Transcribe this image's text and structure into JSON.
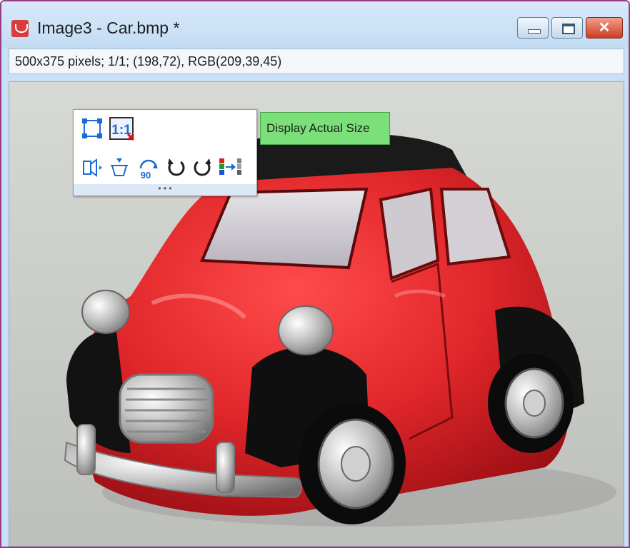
{
  "window": {
    "title": "Image3 - Car.bmp *",
    "icon": "app-logo-icon",
    "controls": {
      "minimize_icon": "minimize-icon",
      "maximize_icon": "maximize-icon",
      "close_label": "✕"
    }
  },
  "status": {
    "text": "500x375 pixels; 1/1; (198,72), RGB(209,39,45)"
  },
  "toolbar": {
    "row1": [
      {
        "name": "fit-to-window-icon",
        "active": false
      },
      {
        "name": "actual-size-icon",
        "label": "1:1",
        "active": true
      }
    ],
    "row2": [
      {
        "name": "flip-horizontal-icon"
      },
      {
        "name": "flip-vertical-icon"
      },
      {
        "name": "rotate-90-icon",
        "label": "90"
      },
      {
        "name": "rotate-left-icon"
      },
      {
        "name": "rotate-right-icon"
      },
      {
        "name": "color-channel-icon"
      }
    ],
    "grip_label": "• • •"
  },
  "tooltip": {
    "text": "Display Actual Size"
  },
  "colors": {
    "accent": "#9a3c84",
    "tooltip_bg": "#7ce07a",
    "car_red": "#e0262a",
    "title_bg": "#c9e1f7"
  }
}
